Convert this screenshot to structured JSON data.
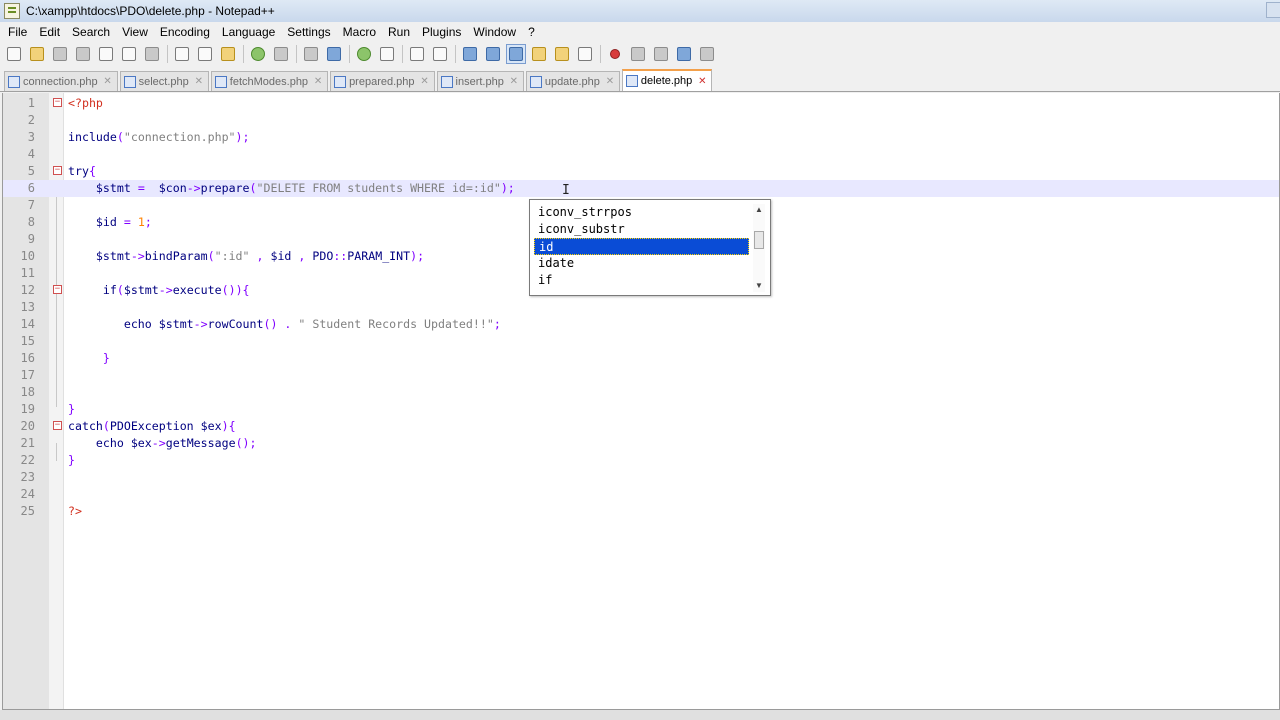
{
  "window": {
    "title": "C:\\xampp\\htdocs\\PDO\\delete.php - Notepad++"
  },
  "menu": [
    "File",
    "Edit",
    "Search",
    "View",
    "Encoding",
    "Language",
    "Settings",
    "Macro",
    "Run",
    "Plugins",
    "Window",
    "?"
  ],
  "tabs": [
    {
      "label": "connection.php",
      "active": false
    },
    {
      "label": "select.php",
      "active": false
    },
    {
      "label": "fetchModes.php",
      "active": false
    },
    {
      "label": "prepared.php",
      "active": false
    },
    {
      "label": "insert.php",
      "active": false
    },
    {
      "label": "update.php",
      "active": false
    },
    {
      "label": "delete.php",
      "active": true
    }
  ],
  "editor": {
    "current_line": 6,
    "lines": [
      {
        "num": "1",
        "fold": "box",
        "tokens": [
          [
            "php",
            "<?php"
          ]
        ]
      },
      {
        "num": "2",
        "tokens": []
      },
      {
        "num": "3",
        "tokens": [
          [
            "kw",
            "include"
          ],
          [
            "op",
            "("
          ],
          [
            "str",
            "\"connection.php\""
          ],
          [
            "op",
            ");"
          ]
        ]
      },
      {
        "num": "4",
        "tokens": []
      },
      {
        "num": "5",
        "fold": "box",
        "tokens": [
          [
            "kw",
            "try"
          ],
          [
            "op",
            "{"
          ]
        ]
      },
      {
        "num": "6",
        "tokens": [
          [
            "",
            "    "
          ],
          [
            "var",
            "$stmt"
          ],
          [
            "",
            " "
          ],
          [
            "op",
            "="
          ],
          [
            "",
            "  "
          ],
          [
            "var",
            "$con"
          ],
          [
            "op",
            "->"
          ],
          [
            "kw",
            "prepare"
          ],
          [
            "op",
            "("
          ],
          [
            "str",
            "\"DELETE FROM students WHERE id=:id\""
          ],
          [
            "op",
            ");"
          ]
        ]
      },
      {
        "num": "7",
        "tokens": []
      },
      {
        "num": "8",
        "tokens": [
          [
            "",
            "    "
          ],
          [
            "var",
            "$id"
          ],
          [
            "",
            " "
          ],
          [
            "op",
            "="
          ],
          [
            "",
            " "
          ],
          [
            "num",
            "1"
          ],
          [
            "op",
            ";"
          ]
        ]
      },
      {
        "num": "9",
        "tokens": []
      },
      {
        "num": "10",
        "tokens": [
          [
            "",
            "    "
          ],
          [
            "var",
            "$stmt"
          ],
          [
            "op",
            "->"
          ],
          [
            "kw",
            "bindParam"
          ],
          [
            "op",
            "("
          ],
          [
            "str",
            "\":id\""
          ],
          [
            "",
            " "
          ],
          [
            "op",
            ","
          ],
          [
            "",
            " "
          ],
          [
            "var",
            "$id"
          ],
          [
            "",
            " "
          ],
          [
            "op",
            ","
          ],
          [
            "",
            " "
          ],
          [
            "kw",
            "PDO"
          ],
          [
            "op",
            "::"
          ],
          [
            "kw",
            "PARAM_INT"
          ],
          [
            "op",
            ");"
          ]
        ]
      },
      {
        "num": "11",
        "tokens": []
      },
      {
        "num": "12",
        "fold": "box",
        "tokens": [
          [
            "",
            "     "
          ],
          [
            "kw",
            "if"
          ],
          [
            "op",
            "("
          ],
          [
            "var",
            "$stmt"
          ],
          [
            "op",
            "->"
          ],
          [
            "kw",
            "execute"
          ],
          [
            "op",
            "()){"
          ]
        ]
      },
      {
        "num": "13",
        "tokens": []
      },
      {
        "num": "14",
        "tokens": [
          [
            "",
            "        "
          ],
          [
            "kw",
            "echo"
          ],
          [
            "",
            " "
          ],
          [
            "var",
            "$stmt"
          ],
          [
            "op",
            "->"
          ],
          [
            "kw",
            "rowCount"
          ],
          [
            "op",
            "()"
          ],
          [
            "",
            " "
          ],
          [
            "op",
            "."
          ],
          [
            "",
            " "
          ],
          [
            "str",
            "\" Student Records Updated!!\""
          ],
          [
            "op",
            ";"
          ]
        ]
      },
      {
        "num": "15",
        "tokens": []
      },
      {
        "num": "16",
        "tokens": [
          [
            "",
            "     "
          ],
          [
            "op",
            "}"
          ]
        ]
      },
      {
        "num": "17",
        "tokens": []
      },
      {
        "num": "18",
        "tokens": []
      },
      {
        "num": "19",
        "tokens": [
          [
            "op",
            "}"
          ]
        ]
      },
      {
        "num": "20",
        "fold": "box",
        "tokens": [
          [
            "kw",
            "catch"
          ],
          [
            "op",
            "("
          ],
          [
            "kw",
            "PDOException"
          ],
          [
            "",
            " "
          ],
          [
            "var",
            "$ex"
          ],
          [
            "op",
            "){"
          ]
        ]
      },
      {
        "num": "21",
        "tokens": [
          [
            "",
            "    "
          ],
          [
            "kw",
            "echo"
          ],
          [
            "",
            " "
          ],
          [
            "var",
            "$ex"
          ],
          [
            "op",
            "->"
          ],
          [
            "kw",
            "getMessage"
          ],
          [
            "op",
            "();"
          ]
        ]
      },
      {
        "num": "22",
        "tokens": [
          [
            "op",
            "}"
          ]
        ]
      },
      {
        "num": "23",
        "tokens": []
      },
      {
        "num": "24",
        "tokens": []
      },
      {
        "num": "25",
        "tokens": [
          [
            "php",
            "?>"
          ]
        ]
      }
    ]
  },
  "autocomplete": {
    "items": [
      "iconv_strrpos",
      "iconv_substr",
      "id",
      "idate",
      "if"
    ],
    "selected": "id",
    "scroll_up": "▲",
    "scroll_down": "▼"
  },
  "cursor_glyph": "I",
  "colors": {
    "selection": "#0a4cd6",
    "current_line": "#e8e8ff",
    "active_tab_accent": "#f3a04a"
  }
}
